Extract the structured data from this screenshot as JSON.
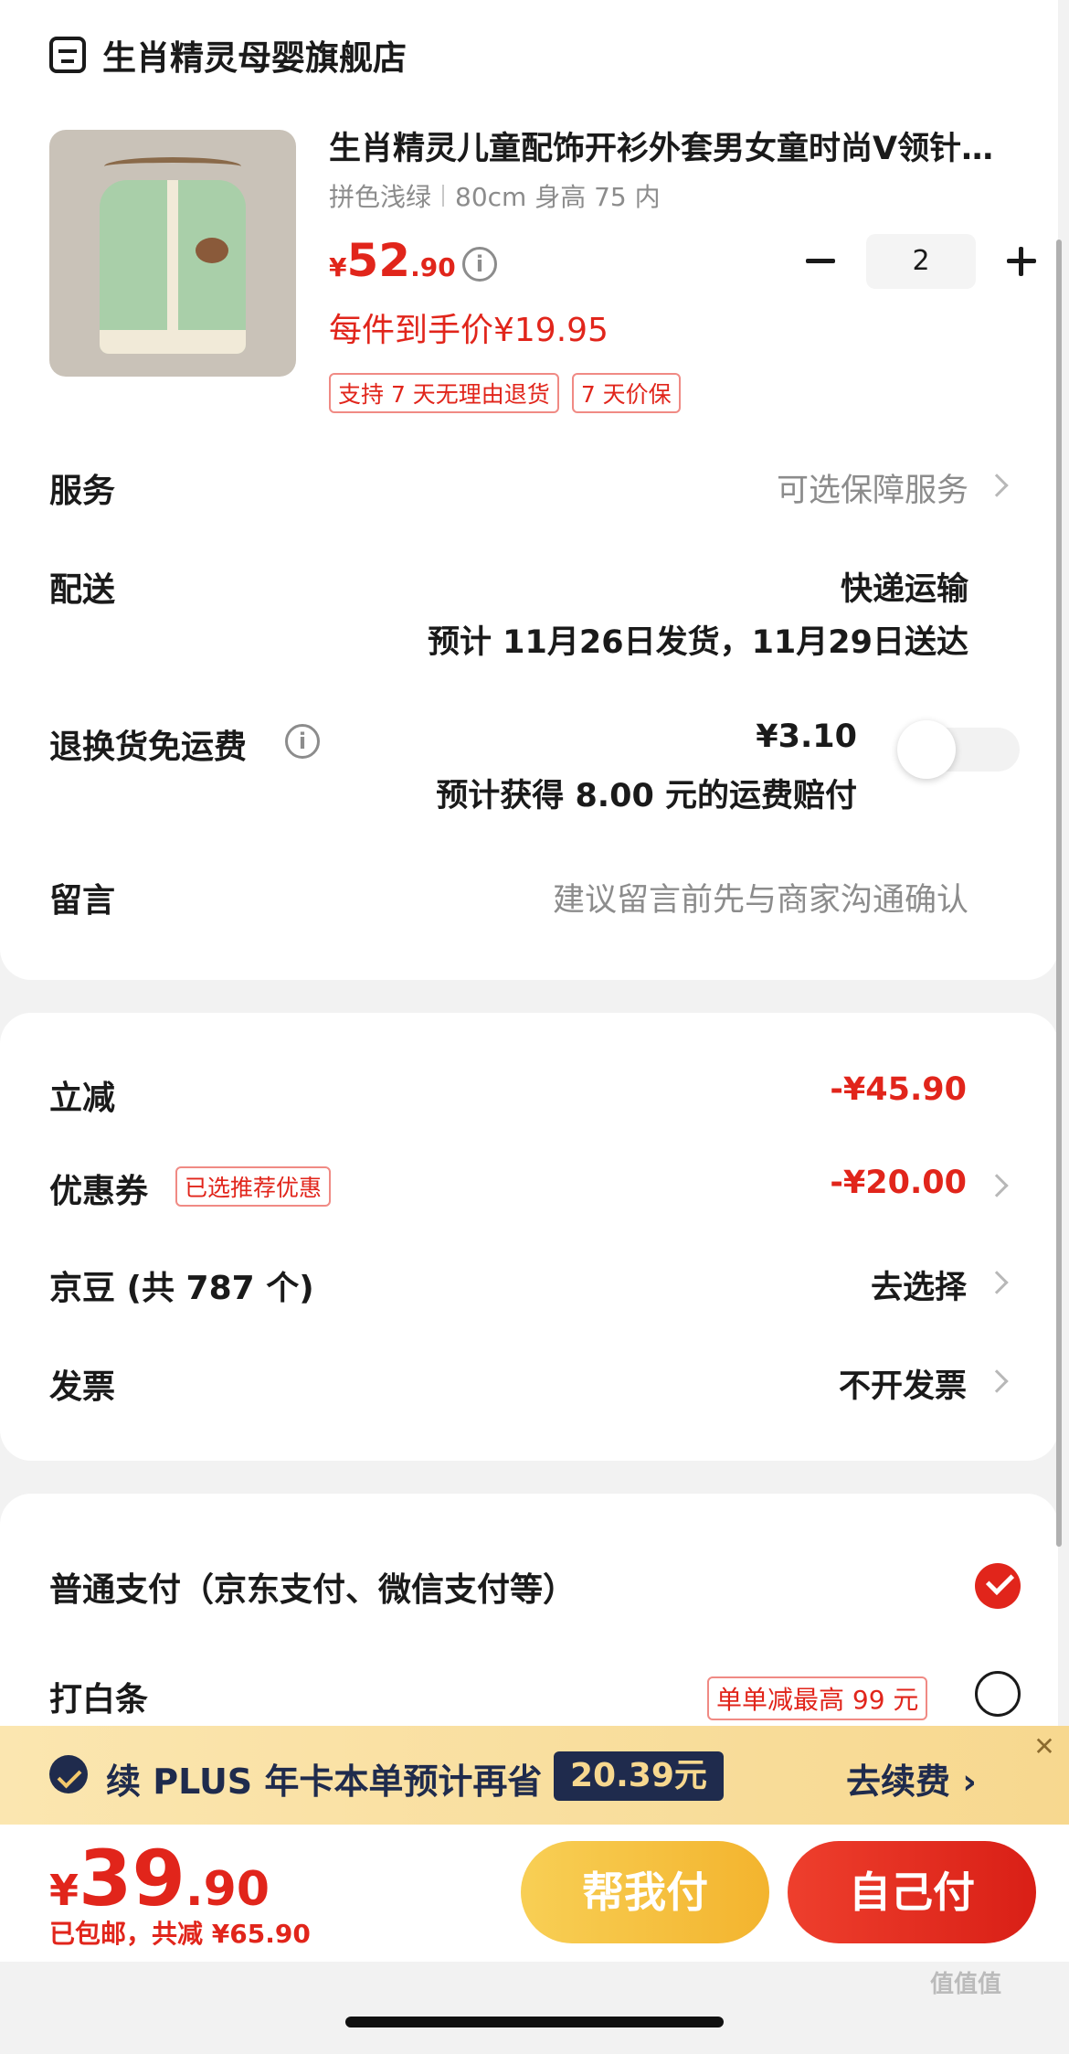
{
  "store": {
    "name": "生肖精灵母婴旗舰店",
    "icon": "store-icon"
  },
  "product": {
    "title": "生肖精灵儿童配饰开衫外套男女童时尚V领针织衫宝宝",
    "color": "拼色浅绿",
    "size": "80cm 身高 75 内",
    "price_yen": "¥",
    "price_int": "52",
    "price_dec": ".90",
    "deal_price": "每件到手价¥19.95",
    "tags": [
      "支持 7 天无理由退货",
      "7 天价保"
    ],
    "quantity": "2"
  },
  "service": {
    "label": "服务",
    "value": "可选保障服务"
  },
  "delivery": {
    "label": "配送",
    "method": "快递运输",
    "schedule": "预计 11月26日发货，11月29日送达"
  },
  "return_shipping": {
    "label": "退换货免运费",
    "price": "¥3.10",
    "note": "预计获得 8.00 元的运费赔付",
    "enabled": false
  },
  "message": {
    "label": "留言",
    "placeholder": "建议留言前先与商家沟通确认"
  },
  "discounts": {
    "instant": {
      "label": "立减",
      "value": "-¥45.90"
    },
    "coupon": {
      "label": "优惠券",
      "tag": "已选推荐优惠",
      "value": "-¥20.00"
    },
    "beans": {
      "label": "京豆 (共 787 个)",
      "value": "去选择"
    },
    "invoice": {
      "label": "发票",
      "value": "不开发票"
    }
  },
  "payment": {
    "normal": {
      "label": "普通支付（京东支付、微信支付等）",
      "selected": true
    },
    "baitiao": {
      "label": "打白条",
      "promo": "单单减最高 99 元",
      "selected": false
    }
  },
  "plus_banner": {
    "text": "续 PLUS 年卡本单预计再省",
    "amount": "20.39元",
    "action": "去续费 ›",
    "close": "✕"
  },
  "bottom": {
    "total_yen": "¥",
    "total_int": "39",
    "total_dec": ".90",
    "sub": "已包邮，共减 ¥65.90",
    "help_pay": "帮我付",
    "self_pay": "自己付"
  },
  "watermark": "值值值",
  "colors": {
    "accent_red": "#e1251b",
    "plus_navy": "#1f2b4d",
    "plus_gold": "#f7d88f"
  }
}
